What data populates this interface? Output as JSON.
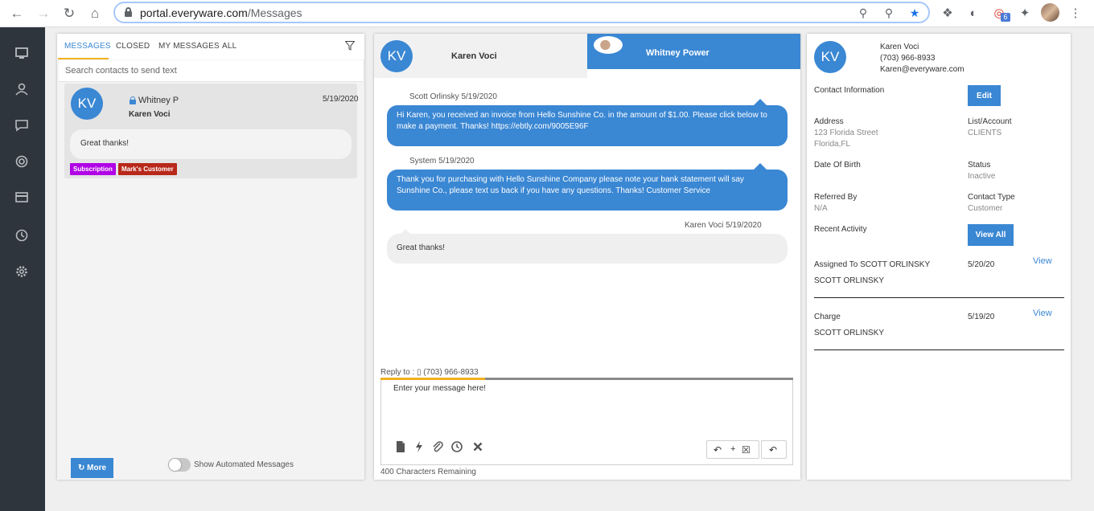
{
  "browser": {
    "url_host": "portal.everyware.com",
    "url_path": "/Messages",
    "ext_badge": "6"
  },
  "tabs": [
    {
      "label": "MESSAGES",
      "active": true
    },
    {
      "label": "CLOSED"
    },
    {
      "label": "MY MESSAGES"
    },
    {
      "label": "ALL"
    }
  ],
  "search": {
    "placeholder": "Search contacts to send text"
  },
  "conversation": {
    "initials": "KV",
    "assignee": "Whitney P",
    "date": "5/19/2020",
    "name": "Karen Voci",
    "preview": "Great thanks!",
    "tags": [
      "Subscription",
      "Mark's Customer"
    ]
  },
  "left_footer": {
    "more_label": "More",
    "toggle_label": "Show Automated Messages"
  },
  "chat": {
    "contact_initials": "KV",
    "contact_name": "Karen Voci",
    "agent_name": "Whitney Power",
    "messages": [
      {
        "meta": "Scott Orlinsky 5/19/2020",
        "text": "Hi Karen, you received an invoice from Hello Sunshine Co. in the amount of $1.00. Please click below to make a payment. Thanks! https://ebtly.com/9005E96F"
      },
      {
        "meta": "System 5/19/2020",
        "text": "Thank you for purchasing with Hello Sunshine Company please note your bank statement will say Sunshine Co., please text us back if you have any questions. Thanks! Customer Service"
      },
      {
        "meta": "Karen Voci 5/19/2020",
        "text": "Great thanks!"
      }
    ],
    "reply_to": "Reply to : ▯ (703) 966-8933",
    "composer_placeholder": "Enter your message here!",
    "chars_remaining": "400 Characters Remaining",
    "plus": "+"
  },
  "contact": {
    "initials": "KV",
    "name": "Karen Voci",
    "phone": "(703) 966-8933",
    "email": "Karen@everyware.com",
    "contact_info_label": "Contact Information",
    "edit_label": "Edit",
    "address_label": "Address",
    "address_line1": "123 Florida Street",
    "address_line2": "Florida,FL",
    "list_label": "List/Account",
    "list_value": "CLIENTS",
    "dob_label": "Date Of Birth",
    "status_label": "Status",
    "status_value": "Inactive",
    "referred_label": "Referred By",
    "referred_value": "N/A",
    "type_label": "Contact Type",
    "type_value": "Customer",
    "recent_label": "Recent Activity",
    "view_all_label": "View All",
    "activities": [
      {
        "title": "Assigned To SCOTT ORLINSKY",
        "date": "5/20/20",
        "user": "SCOTT ORLINSKY",
        "link": "View"
      },
      {
        "title": "Charge",
        "date": "5/19/20",
        "user": "SCOTT ORLINSKY",
        "link": "View"
      }
    ]
  },
  "colors": {
    "accent": "#3a87d3",
    "highlight": "#f2b01e",
    "sidebar": "#2f353d"
  }
}
